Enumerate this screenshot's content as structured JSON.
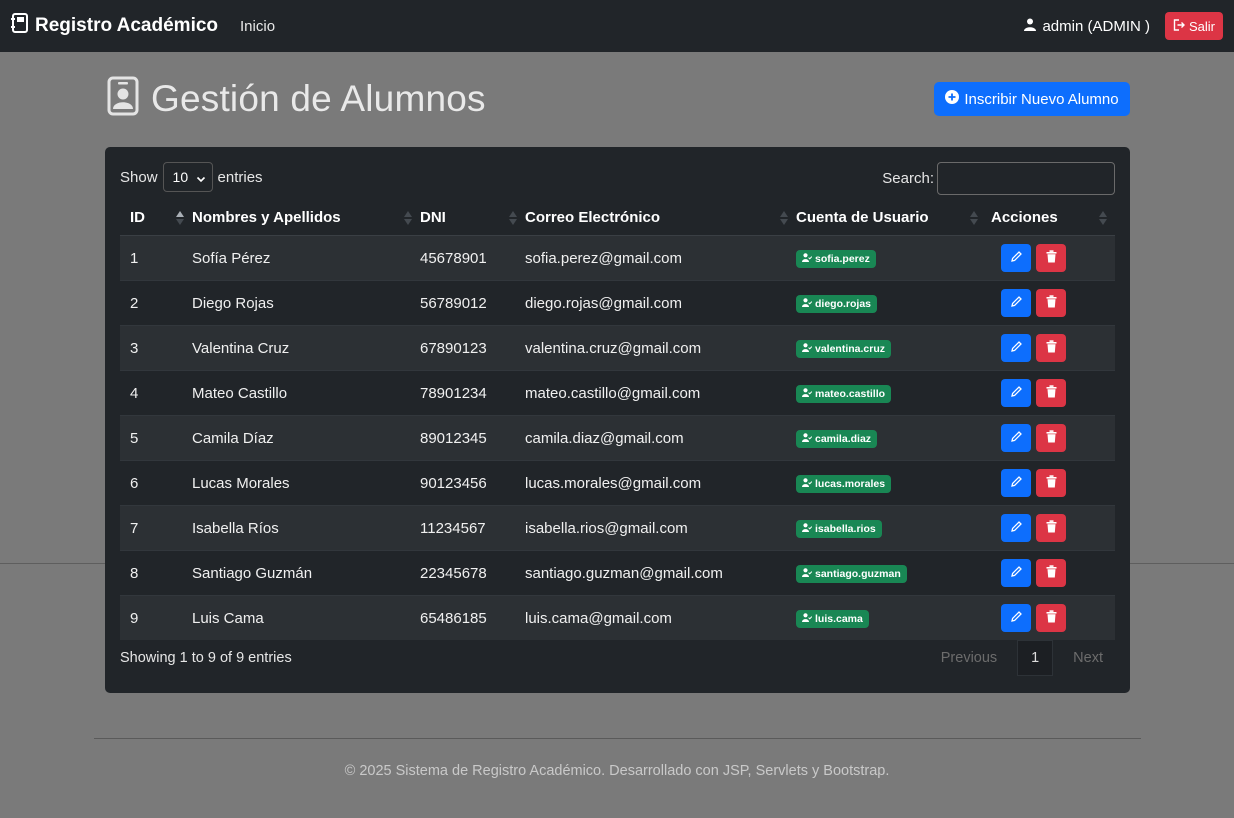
{
  "navbar": {
    "brand": "Registro Académico",
    "home_link": "Inicio",
    "user_label": "admin (ADMIN )",
    "logout_label": "Salir"
  },
  "header": {
    "title": "Gestión de Alumnos",
    "add_button": "Inscribir Nuevo Alumno"
  },
  "table_controls": {
    "show_label": "Show",
    "entries_label": "entries",
    "page_size": "10",
    "search_label": "Search:"
  },
  "columns": [
    "ID",
    "Nombres y Apellidos",
    "DNI",
    "Correo Electrónico",
    "Cuenta de Usuario",
    "Acciones"
  ],
  "rows": [
    {
      "id": "1",
      "name": "Sofía Pérez",
      "dni": "45678901",
      "email": "sofia.perez@gmail.com",
      "user": "sofia.perez"
    },
    {
      "id": "2",
      "name": "Diego Rojas",
      "dni": "56789012",
      "email": "diego.rojas@gmail.com",
      "user": "diego.rojas"
    },
    {
      "id": "3",
      "name": "Valentina Cruz",
      "dni": "67890123",
      "email": "valentina.cruz@gmail.com",
      "user": "valentina.cruz"
    },
    {
      "id": "4",
      "name": "Mateo Castillo",
      "dni": "78901234",
      "email": "mateo.castillo@gmail.com",
      "user": "mateo.castillo"
    },
    {
      "id": "5",
      "name": "Camila Díaz",
      "dni": "89012345",
      "email": "camila.diaz@gmail.com",
      "user": "camila.diaz"
    },
    {
      "id": "6",
      "name": "Lucas Morales",
      "dni": "90123456",
      "email": "lucas.morales@gmail.com",
      "user": "lucas.morales"
    },
    {
      "id": "7",
      "name": "Isabella Ríos",
      "dni": "11234567",
      "email": "isabella.rios@gmail.com",
      "user": "isabella.rios"
    },
    {
      "id": "8",
      "name": "Santiago Guzmán",
      "dni": "22345678",
      "email": "santiago.guzman@gmail.com",
      "user": "santiago.guzman"
    },
    {
      "id": "9",
      "name": "Luis Cama",
      "dni": "65486185",
      "email": "luis.cama@gmail.com",
      "user": "luis.cama"
    }
  ],
  "pagination": {
    "info": "Showing 1 to 9 of 9 entries",
    "previous": "Previous",
    "current_page": "1",
    "next": "Next"
  },
  "footer": {
    "text": "© 2025 Sistema de Registro Académico. Desarrollado con JSP, Servlets y Bootstrap."
  },
  "colors": {
    "primary": "#0d6efd",
    "danger": "#dc3545",
    "success": "#198754",
    "dark": "#212529"
  }
}
